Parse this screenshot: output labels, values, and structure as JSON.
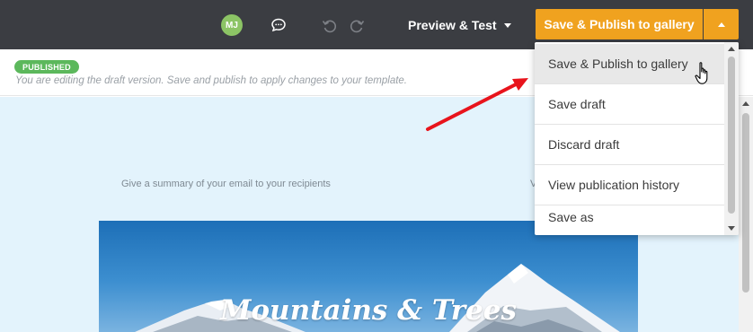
{
  "topbar": {
    "avatar_initials": "MJ",
    "comment_icon": "comment-icon",
    "undo_icon": "undo-icon",
    "redo_icon": "redo-icon",
    "preview_label": "Preview & Test",
    "publish_label": "Save & Publish to gallery",
    "colors": {
      "bg": "#3b3d42",
      "accent": "#f0a21f",
      "avatar": "#8cc465"
    }
  },
  "status": {
    "badge": "PUBLISHED",
    "hint": "You are editing the draft version. Save and publish to apply changes to your template.",
    "badge_color": "#5cb85c"
  },
  "dropdown": {
    "items": [
      {
        "label": "Save & Publish to gallery"
      },
      {
        "label": "Save draft"
      },
      {
        "label": "Discard draft"
      },
      {
        "label": "View publication history"
      },
      {
        "label": "Save as"
      }
    ]
  },
  "canvas": {
    "summary": "Give a summary of your email to your recipients",
    "view_online_fragment": "V",
    "hero_title": "Mountains & Trees"
  }
}
